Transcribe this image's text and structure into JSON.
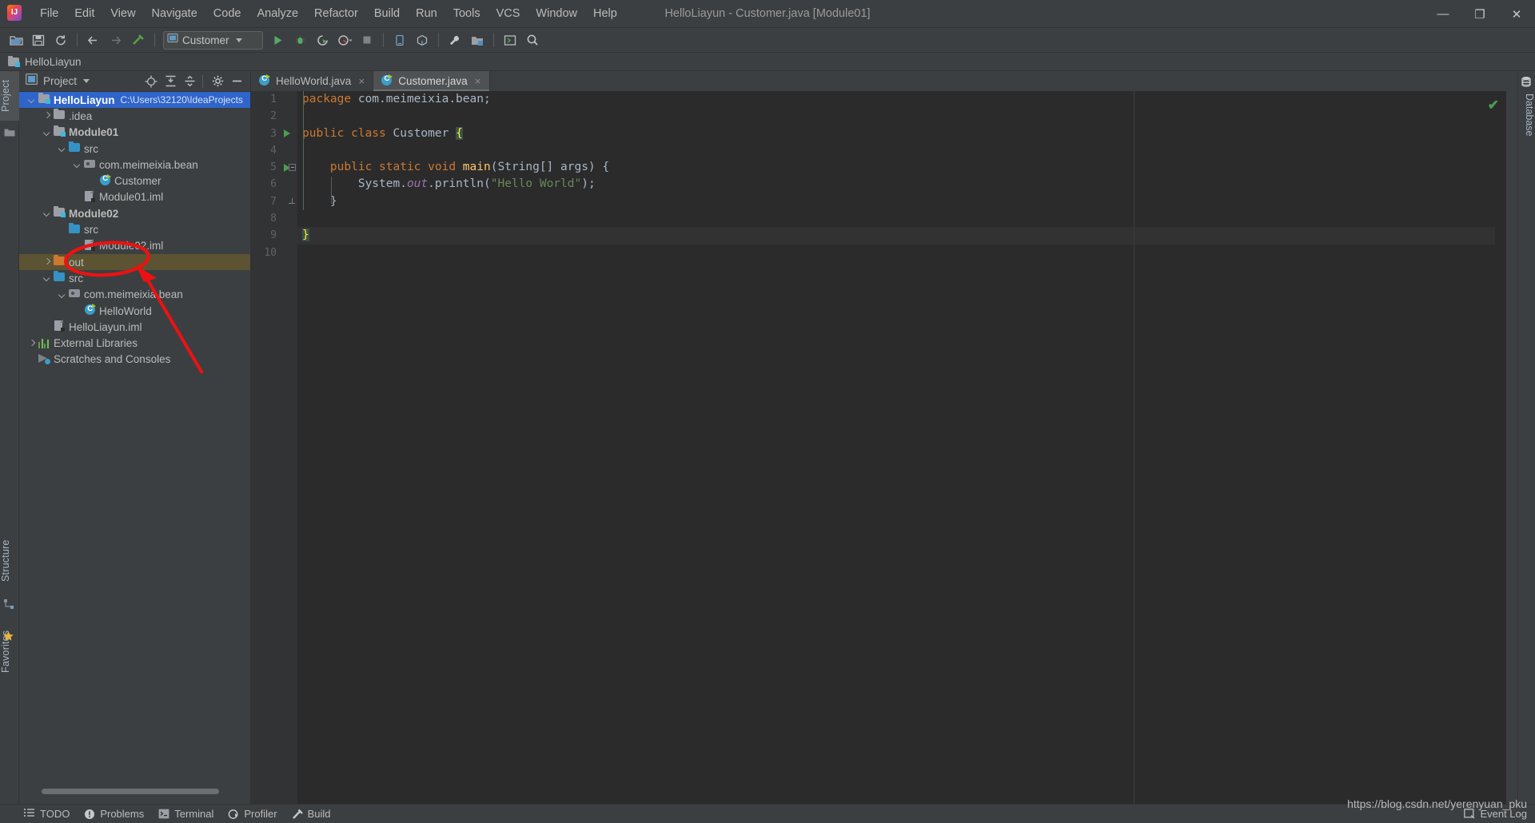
{
  "window": {
    "title": "HelloLiayun - Customer.java [Module01]",
    "app_icon": "intellij-idea-logo",
    "minimize": "—",
    "maximize": "❐",
    "close": "✕"
  },
  "menu": {
    "items": [
      "File",
      "Edit",
      "View",
      "Navigate",
      "Code",
      "Analyze",
      "Refactor",
      "Build",
      "Run",
      "Tools",
      "VCS",
      "Window",
      "Help"
    ]
  },
  "toolbar": {
    "icons": [
      "open-folder-icon",
      "save-icon",
      "sync-icon",
      "back-arrow-icon",
      "forward-arrow-icon",
      "build-hammer-icon"
    ],
    "run_config": {
      "label": "Customer",
      "icon": "run-config-icon"
    },
    "run_label": "run-icon",
    "debug_label": "debug-icon",
    "coverage_label": "run-with-coverage-icon",
    "profile_label": "profiler-icon",
    "stop_label": "stop-icon",
    "right_icons": [
      "device-manager-icon",
      "sdk-icon",
      "settings-wrench-icon",
      "project-structure-icon",
      "terminal-icon",
      "search-icon"
    ]
  },
  "navbar": {
    "crumb": "HelloLiayun",
    "icon": "module-folder-icon"
  },
  "left_strip": {
    "tabs": [
      "Project",
      "Structure",
      "Favorites"
    ],
    "active": "Project",
    "bookmark_icon": "star-icon"
  },
  "right_strip": {
    "tabs": [
      "Database"
    ]
  },
  "project_panel": {
    "title": "Project",
    "title_icon": "project-view-icon",
    "actions": [
      "locate-icon",
      "expand-all-icon",
      "collapse-all-icon",
      "settings-gear-icon",
      "hide-icon"
    ],
    "tree": [
      {
        "depth": 0,
        "arrow": "down",
        "icon": "module-folder",
        "label": "HelloLiayun",
        "bold": true,
        "path": "C:\\Users\\32120\\IdeaProjects",
        "state": "selected"
      },
      {
        "depth": 1,
        "arrow": "right",
        "icon": "folder",
        "label": ".idea",
        "bold": false,
        "path": "",
        "state": "normal"
      },
      {
        "depth": 1,
        "arrow": "down",
        "icon": "module-folder",
        "label": "Module01",
        "bold": true,
        "path": "",
        "state": "normal"
      },
      {
        "depth": 2,
        "arrow": "down",
        "icon": "source-folder",
        "label": "src",
        "bold": false,
        "path": "",
        "state": "normal"
      },
      {
        "depth": 3,
        "arrow": "down",
        "icon": "package",
        "label": "com.meimeixia.bean",
        "bold": false,
        "path": "",
        "state": "normal"
      },
      {
        "depth": 4,
        "arrow": "none",
        "icon": "java-class",
        "label": "Customer",
        "bold": false,
        "path": "",
        "state": "normal"
      },
      {
        "depth": 3,
        "arrow": "none",
        "icon": "iml-file",
        "label": "Module01.iml",
        "bold": false,
        "path": "",
        "state": "normal"
      },
      {
        "depth": 1,
        "arrow": "down",
        "icon": "module-folder",
        "label": "Module02",
        "bold": true,
        "path": "",
        "state": "normal"
      },
      {
        "depth": 2,
        "arrow": "none",
        "icon": "source-folder",
        "label": "src",
        "bold": false,
        "path": "",
        "state": "normal"
      },
      {
        "depth": 3,
        "arrow": "none",
        "icon": "iml-file",
        "label": "Module02.iml",
        "bold": false,
        "path": "",
        "state": "normal"
      },
      {
        "depth": 1,
        "arrow": "right",
        "icon": "output-folder",
        "label": "out",
        "bold": false,
        "path": "",
        "state": "highlighted"
      },
      {
        "depth": 1,
        "arrow": "down",
        "icon": "source-folder",
        "label": "src",
        "bold": false,
        "path": "",
        "state": "normal"
      },
      {
        "depth": 2,
        "arrow": "down",
        "icon": "package",
        "label": "com.meimeixia.bean",
        "bold": false,
        "path": "",
        "state": "normal"
      },
      {
        "depth": 3,
        "arrow": "none",
        "icon": "java-class",
        "label": "HelloWorld",
        "bold": false,
        "path": "",
        "state": "normal"
      },
      {
        "depth": 1,
        "arrow": "none",
        "icon": "iml-file",
        "label": "HelloLiayun.iml",
        "bold": false,
        "path": "",
        "state": "normal"
      },
      {
        "depth": 0,
        "arrow": "right",
        "icon": "external-libraries",
        "label": "External Libraries",
        "bold": false,
        "path": "",
        "state": "normal"
      },
      {
        "depth": 0,
        "arrow": "none",
        "icon": "scratches",
        "label": "Scratches and Consoles",
        "bold": false,
        "path": "",
        "state": "normal"
      }
    ]
  },
  "editor": {
    "tabs": [
      {
        "label": "HelloWorld.java",
        "icon": "java-class",
        "active": false,
        "close": "×"
      },
      {
        "label": "Customer.java",
        "icon": "java-class",
        "active": true,
        "close": "×"
      }
    ],
    "line_numbers": [
      "1",
      "2",
      "3",
      "4",
      "5",
      "6",
      "7",
      "8",
      "9",
      "10"
    ],
    "gutter_marks": {
      "3": "run-arrow-icon",
      "5": "run-arrow-icon",
      "5b": "fold-collapse-icon",
      "7": "fold-end-icon"
    },
    "current_line": 9,
    "status_ok": "✔",
    "code_lines": [
      {
        "n": 1,
        "tokens": [
          {
            "t": "package ",
            "c": "k"
          },
          {
            "t": "com.meimeixia.bean;",
            "c": "cl"
          }
        ]
      },
      {
        "n": 2,
        "tokens": []
      },
      {
        "n": 3,
        "tokens": [
          {
            "t": "public ",
            "c": "k"
          },
          {
            "t": "class ",
            "c": "k"
          },
          {
            "t": "Customer ",
            "c": "cl"
          },
          {
            "t": "{",
            "c": "brhl"
          }
        ]
      },
      {
        "n": 4,
        "tokens": []
      },
      {
        "n": 5,
        "tokens": [
          {
            "t": "    ",
            "c": "cl"
          },
          {
            "t": "public ",
            "c": "k"
          },
          {
            "t": "static ",
            "c": "k"
          },
          {
            "t": "void ",
            "c": "k"
          },
          {
            "t": "main",
            "c": "fn"
          },
          {
            "t": "(String[] args) {",
            "c": "cl"
          }
        ]
      },
      {
        "n": 6,
        "tokens": [
          {
            "t": "        System.",
            "c": "cl"
          },
          {
            "t": "out",
            "c": "fi"
          },
          {
            "t": ".println(",
            "c": "cl"
          },
          {
            "t": "\"Hello World\"",
            "c": "st"
          },
          {
            "t": ");",
            "c": "cl"
          }
        ]
      },
      {
        "n": 7,
        "tokens": [
          {
            "t": "    }",
            "c": "cl"
          }
        ]
      },
      {
        "n": 8,
        "tokens": []
      },
      {
        "n": 9,
        "tokens": [
          {
            "t": "}",
            "c": "brhl"
          }
        ]
      },
      {
        "n": 10,
        "tokens": []
      }
    ]
  },
  "statusbar": {
    "items": [
      {
        "label": "TODO",
        "icon": "todo-list-icon"
      },
      {
        "label": "Problems",
        "icon": "problems-icon"
      },
      {
        "label": "Terminal",
        "icon": "terminal-icon"
      },
      {
        "label": "Profiler",
        "icon": "profiler-icon"
      },
      {
        "label": "Build",
        "icon": "build-hammer-icon"
      }
    ],
    "event_log": {
      "label": "Event Log",
      "icon": "event-log-icon"
    }
  },
  "watermark": "https://blog.csdn.net/yerenyuan_pku",
  "annotation": {
    "type": "red-ellipse-with-arrow",
    "target": "Module02",
    "color": "#ee1111"
  },
  "colors": {
    "bg_panel": "#3c3f41",
    "bg_editor": "#2b2b2b",
    "selection_blue": "#2f65ca",
    "highlight_olive": "#5c5333",
    "accent_orange": "#cc7832",
    "string_green": "#6a8759",
    "method_yellow": "#ffc66d",
    "field_purple": "#9876aa",
    "text": "#bbbbbb"
  }
}
